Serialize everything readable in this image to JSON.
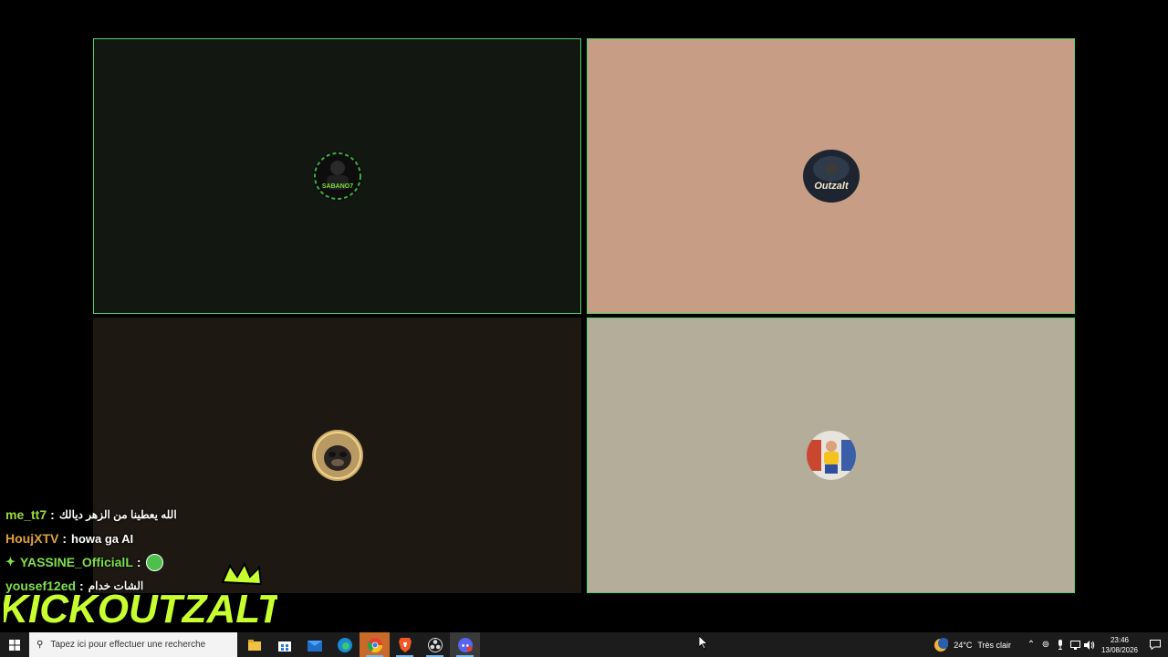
{
  "participants": [
    {
      "id": "tile1",
      "avatar": "sabano7-avatar",
      "avatar_text": "SABANO7",
      "speaking": true
    },
    {
      "id": "tile2",
      "avatar": "outzalt-avatar",
      "avatar_text": "Outzalt",
      "speaking": true
    },
    {
      "id": "tile3",
      "avatar": "monkey-avatar",
      "speaking": false
    },
    {
      "id": "tile4",
      "avatar": "child-photo-avatar",
      "speaking": true
    }
  ],
  "chat": [
    {
      "user": "me_tt7",
      "separator": ":",
      "message": "الله يعطينا من الزهر ديالك",
      "color": "#9bdc3c"
    },
    {
      "user": "HoujXTV",
      "separator": ":",
      "message": "howa ga AI",
      "color": "#e2a13d"
    },
    {
      "user": "YASSINE_OfficialL",
      "separator": ":",
      "message": "",
      "color": "#7ee04a",
      "badge": "diamond-badge-icon",
      "emote": "green-emote-icon"
    },
    {
      "user": "yousef12ed",
      "separator": ":",
      "message": "الشات خدام",
      "color": "#7ee04a"
    }
  ],
  "logo": {
    "text": "KICKOUTZALT",
    "color": "#c8ff2e"
  },
  "taskbar": {
    "search_placeholder": "Tapez ici pour effectuer une recherche",
    "apps": [
      "file-explorer-icon",
      "store-icon",
      "mail-icon",
      "edge-icon",
      "chrome-icon",
      "brave-icon",
      "obs-icon",
      "discord-icon"
    ],
    "weather_temp": "24°C",
    "weather_desc": "Très clair",
    "time": "23:46",
    "date": "13/08/2026"
  }
}
